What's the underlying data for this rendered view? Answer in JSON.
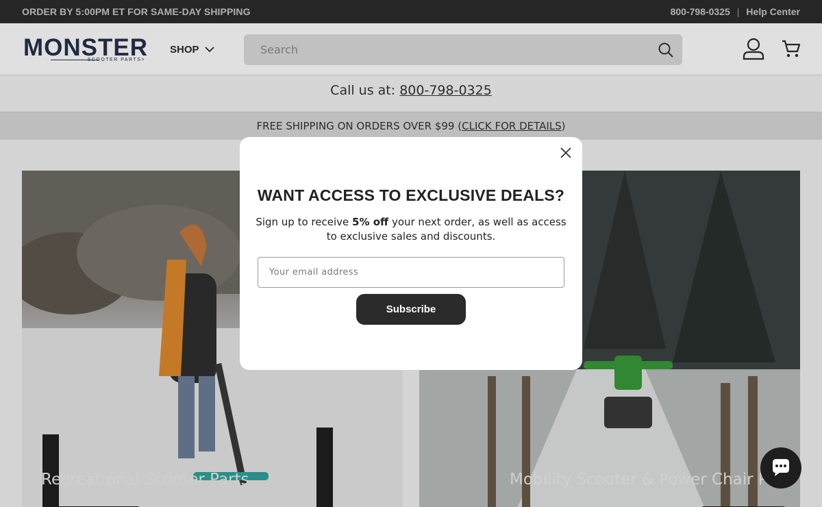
{
  "announcement": {
    "left_text": "ORDER BY 5:00PM ET FOR SAME-DAY SHIPPING",
    "phone": "800-798-0325",
    "separator": "|",
    "help_link": "Help Center"
  },
  "header": {
    "logo_text": "MONSTER",
    "logo_tagline": "SCOOTER PARTS>",
    "shop_label": "SHOP",
    "search_placeholder": "Search",
    "search_value": ""
  },
  "callbar": {
    "prefix": "Call us at:",
    "phone": "800-798-0325"
  },
  "shipbar": {
    "text": "FREE SHIPPING ON ORDERS OVER $99 (",
    "link": "CLICK FOR DETAILS",
    "suffix": ")"
  },
  "tiles": [
    {
      "label": "Recreational Scooter Parts"
    },
    {
      "label": "Mobility Scooter & Power Chair Par"
    }
  ],
  "modal": {
    "title": "WANT ACCESS TO EXCLUSIVE DEALS?",
    "body_prefix": "Sign up to receive ",
    "body_bold": "5% off",
    "body_suffix": " your next order, as well as access to exclusive sales and discounts.",
    "email_placeholder": "Your email address",
    "email_value": "",
    "subscribe_label": "Subscribe"
  },
  "icons": {
    "search": "search-icon",
    "account": "account-icon",
    "cart": "cart-icon",
    "close": "close-icon",
    "chevron": "chevron-down-icon",
    "chat": "chat-icon"
  },
  "colors": {
    "announcement_bg": "#2c2c2c",
    "button_dark": "#2b2b2b",
    "logo_navy": "#23324a",
    "shipbar_bg": "#d9d9d9"
  }
}
